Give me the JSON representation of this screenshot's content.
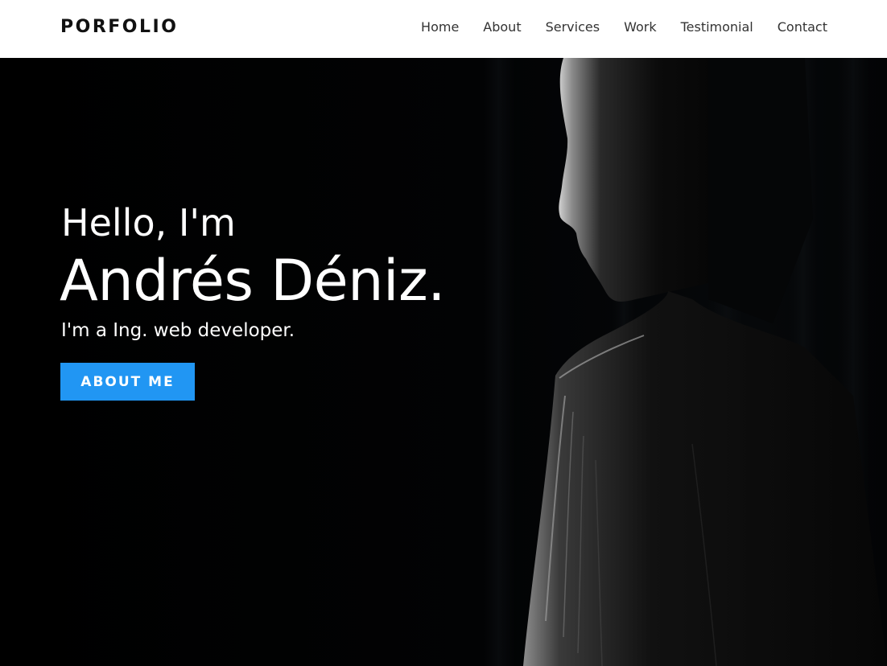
{
  "header": {
    "brand": "PORFOLIO",
    "nav": [
      {
        "label": "Home"
      },
      {
        "label": "About"
      },
      {
        "label": "Services"
      },
      {
        "label": "Work"
      },
      {
        "label": "Testimonial"
      },
      {
        "label": "Contact"
      }
    ]
  },
  "hero": {
    "greeting": "Hello, I'm",
    "name": "Andrés Déniz.",
    "tagline": "I'm a Ing. web developer.",
    "button_label": "About Me",
    "accent_color": "#2196f3",
    "background_color": "#000000"
  }
}
